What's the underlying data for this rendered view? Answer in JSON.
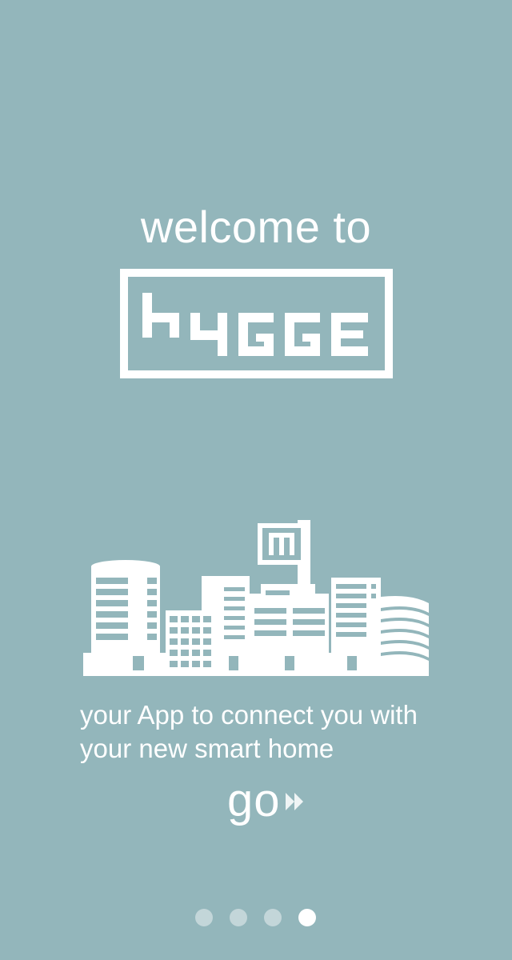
{
  "welcome": {
    "title": "welcome to"
  },
  "logo": {
    "text": "hygge",
    "icon": "hygge-logo"
  },
  "illustration": {
    "icon": "city-skyline-icon"
  },
  "tagline": {
    "line1": "your App to connect you with",
    "line2": "your new smart home"
  },
  "go_button": {
    "label": "go",
    "icon": "double-chevron-right-icon"
  },
  "pager": {
    "active_index": 3,
    "count": 4
  },
  "colors": {
    "background": "#93b6bb",
    "foreground": "#ffffff",
    "dot_inactive": "#c3d6d9"
  }
}
